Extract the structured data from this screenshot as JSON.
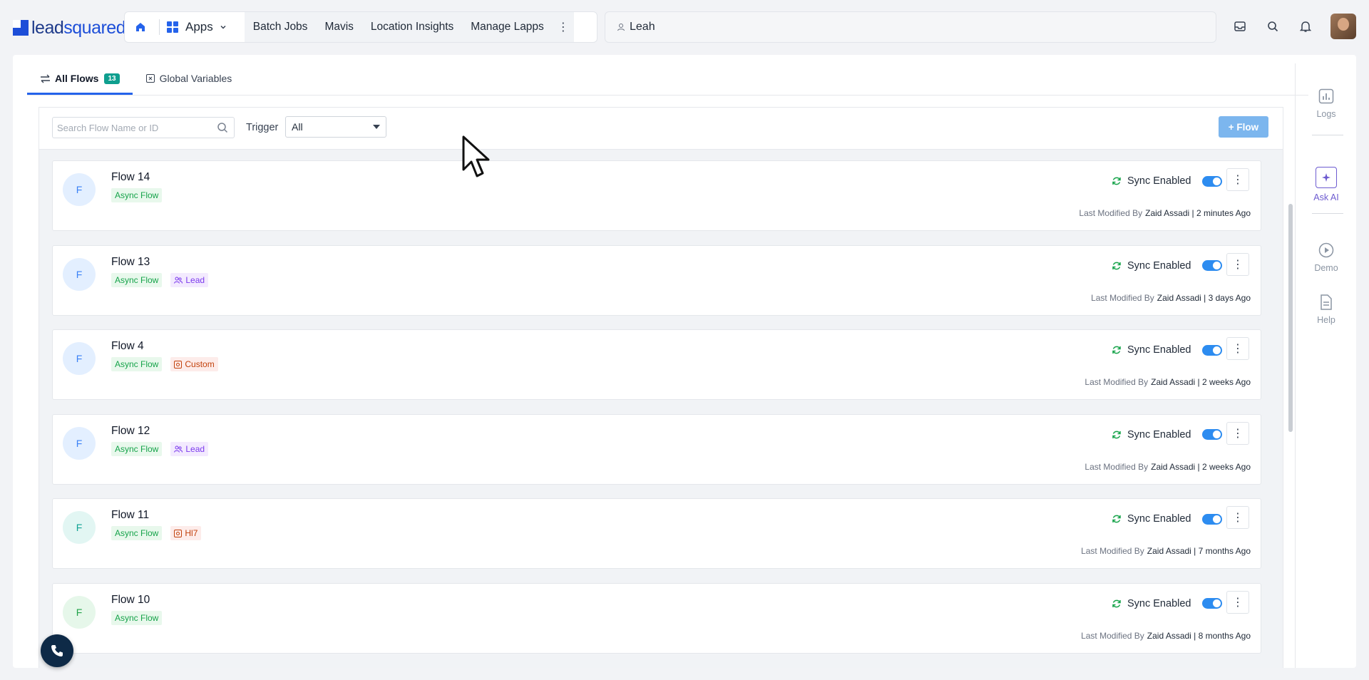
{
  "brand": {
    "logo_text_a": "lead",
    "logo_text_b": "squared"
  },
  "nav": {
    "apps_label": "Apps",
    "links": [
      "Batch Jobs",
      "Mavis",
      "Location Insights",
      "Manage Lapps"
    ]
  },
  "global_search": {
    "value": "Leah"
  },
  "tabs": {
    "all_flows": "All Flows",
    "all_flows_count": "13",
    "global_variables": "Global Variables"
  },
  "toolbar": {
    "search_placeholder": "Search Flow Name or ID",
    "trigger_label": "Trigger",
    "trigger_value": "All",
    "add_flow_label": "+ Flow"
  },
  "flows": [
    {
      "initial": "F",
      "name": "Flow 14",
      "tags": [
        "Async Flow"
      ],
      "sync_label": "Sync Enabled",
      "modified_label": "Last Modified By",
      "modified_by": "Zaid Assadi | 2 minutes Ago"
    },
    {
      "initial": "F",
      "name": "Flow 13",
      "tags": [
        "Async Flow",
        "Lead"
      ],
      "sync_label": "Sync Enabled",
      "modified_label": "Last Modified By",
      "modified_by": "Zaid Assadi | 3 days Ago"
    },
    {
      "initial": "F",
      "name": "Flow 4",
      "tags": [
        "Async Flow",
        "Custom"
      ],
      "sync_label": "Sync Enabled",
      "modified_label": "Last Modified By",
      "modified_by": "Zaid Assadi | 2 weeks Ago"
    },
    {
      "initial": "F",
      "name": "Flow 12",
      "tags": [
        "Async Flow",
        "Lead"
      ],
      "sync_label": "Sync Enabled",
      "modified_label": "Last Modified By",
      "modified_by": "Zaid Assadi | 2 weeks Ago"
    },
    {
      "initial": "F",
      "name": "Flow 11",
      "tags": [
        "Async Flow",
        "Hl7"
      ],
      "sync_label": "Sync Enabled",
      "modified_label": "Last Modified By",
      "modified_by": "Zaid Assadi | 7 months Ago"
    },
    {
      "initial": "F",
      "name": "Flow 10",
      "tags": [
        "Async Flow"
      ],
      "sync_label": "Sync Enabled",
      "modified_label": "Last Modified By",
      "modified_by": "Zaid Assadi | 8 months Ago"
    }
  ],
  "rail": {
    "logs": "Logs",
    "ask_ai": "Ask AI",
    "demo": "Demo",
    "help": "Help"
  },
  "colors": {
    "accent": "#2563eb",
    "toggle_on": "#2d8cf0",
    "async_tag": "#16a34a",
    "lead_tag": "#7c3aed",
    "custom_tag": "#c2410c"
  }
}
